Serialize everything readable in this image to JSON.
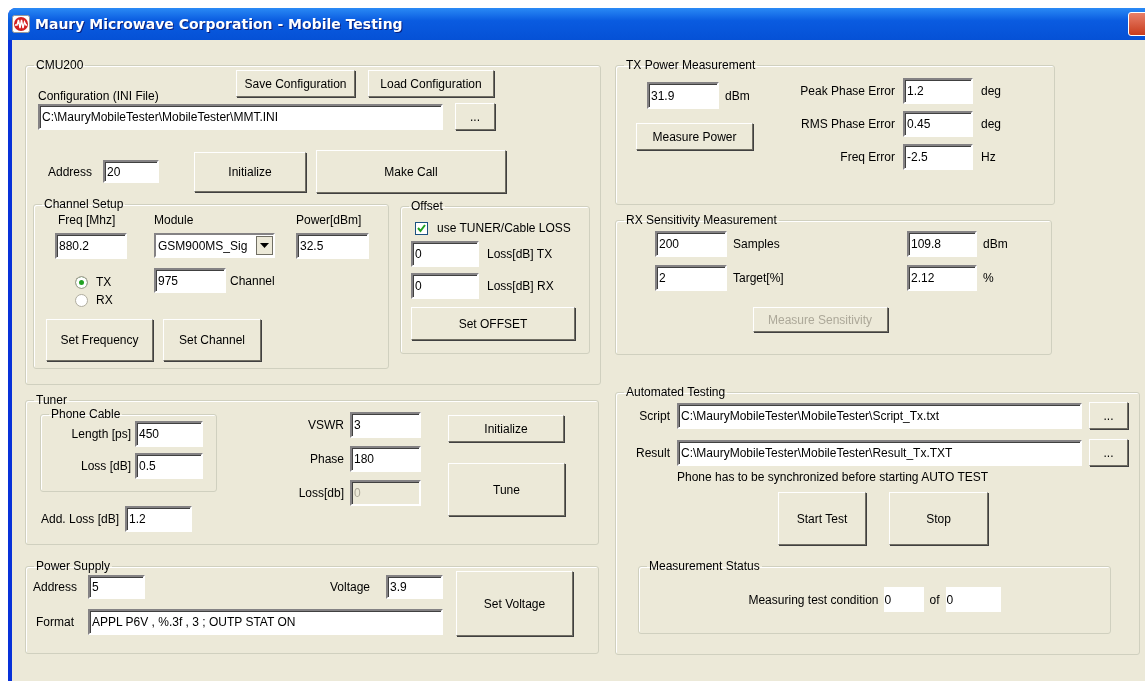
{
  "window": {
    "title": "Maury Microwave Corporation - Mobile Testing"
  },
  "cmu200": {
    "title": "CMU200",
    "save_button": "Save Configuration",
    "load_button": "Load Configuration",
    "config_label": "Configuration (INI File)",
    "config_path": "C:\\MauryMobileTester\\MobileTester\\MMT.INI",
    "browse_button": "...",
    "address_label": "Address",
    "address": "20",
    "initialize_button": "Initialize",
    "make_call_button": "Make Call",
    "channel_setup": {
      "title": "Channel Setup",
      "freq_label": "Freq [Mhz]",
      "freq": "880.2",
      "module_label": "Module",
      "module": "GSM900MS_Sig",
      "power_label": "Power[dBm]",
      "power": "32.5",
      "modes": [
        {
          "label": "TX",
          "selected": true
        },
        {
          "label": "RX",
          "selected": false
        }
      ],
      "channel": "975",
      "channel_label": "Channel",
      "set_frequency_button": "Set Frequency",
      "set_channel_button": "Set Channel"
    },
    "offset": {
      "title": "Offset",
      "use_loss": {
        "label": "use TUNER/Cable LOSS",
        "checked": true
      },
      "loss_tx": "0",
      "loss_tx_label": "Loss[dB] TX",
      "loss_rx": "0",
      "loss_rx_label": "Loss[dB] RX",
      "set_button": "Set OFFSET"
    }
  },
  "tuner": {
    "title": "Tuner",
    "phone_cable": {
      "title": "Phone Cable",
      "length_label": "Length [ps]",
      "length": "450",
      "loss_label": "Loss [dB]",
      "loss": "0.5"
    },
    "add_loss_label": "Add. Loss [dB]",
    "add_loss": "1.2",
    "vswr_label": "VSWR",
    "vswr": "3",
    "phase_label": "Phase",
    "phase": "180",
    "loss_label": "Loss[db]",
    "loss": {
      "value": "0",
      "disabled": true
    },
    "initialize_button": "Initialize",
    "tune_button": "Tune"
  },
  "power_supply": {
    "title": "Power Supply",
    "address_label": "Address",
    "address": "5",
    "voltage_label": "Voltage",
    "voltage": "3.9",
    "format_label": "Format",
    "format": "APPL P6V , %.3f , 3 ; OUTP STAT ON",
    "set_voltage_button": "Set Voltage"
  },
  "tx_power": {
    "title": "TX Power Measurement",
    "power": "31.9",
    "power_unit": "dBm",
    "measure_button": "Measure Power",
    "readings": [
      {
        "label": "Peak Phase Error",
        "value": "1.2",
        "unit": "deg"
      },
      {
        "label": "RMS Phase Error",
        "value": "0.45",
        "unit": "deg"
      },
      {
        "label": "Freq Error",
        "value": "-2.5",
        "unit": "Hz"
      }
    ]
  },
  "rx_sensitivity": {
    "title": "RX Sensitivity Measurement",
    "rows": [
      {
        "input": "200",
        "input_label": "Samples",
        "result": "109.8",
        "result_unit": "dBm"
      },
      {
        "input": "2",
        "input_label": "Target[%]",
        "result": "2.12",
        "result_unit": "%"
      }
    ],
    "measure_button": {
      "label": "Measure Sensitivity",
      "disabled": true
    }
  },
  "automated_testing": {
    "title": "Automated Testing",
    "files": [
      {
        "label": "Script",
        "path": "C:\\MauryMobileTester\\MobileTester\\Script_Tx.txt",
        "browse_button": "..."
      },
      {
        "label": "Result",
        "path": "C:\\MauryMobileTester\\MobileTester\\Result_Tx.TXT",
        "browse_button": "..."
      }
    ],
    "note": "Phone has to be synchronized before starting AUTO TEST",
    "start_button": "Start Test",
    "stop_button": "Stop",
    "status": {
      "title": "Measurement Status",
      "label": "Measuring test condition",
      "current": "0",
      "of_label": "of",
      "total": "0"
    }
  }
}
